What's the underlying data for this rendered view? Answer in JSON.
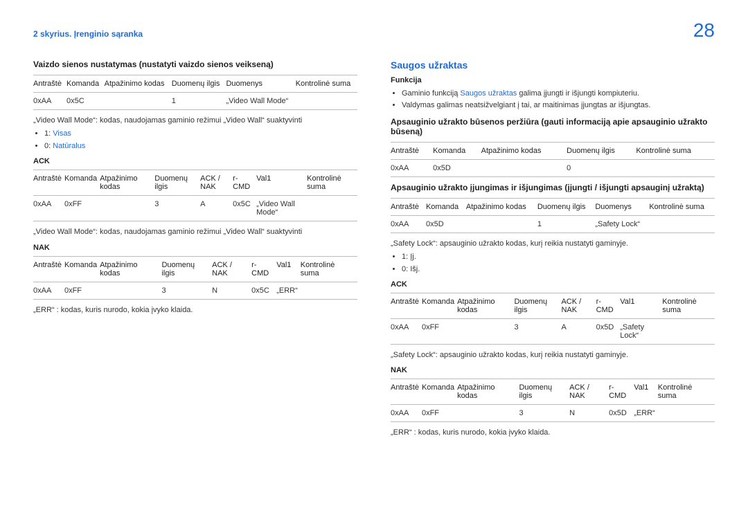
{
  "header": {
    "chapter": "2 skyrius. Įrenginio sąranka",
    "page_number": "28"
  },
  "left": {
    "h1": "Vaizdo sienos nustatymas (nustatyti vaizdo sienos veikseną)",
    "t1": {
      "head": [
        "Antraštė",
        "Komanda",
        "Atpažinimo kodas",
        "Duomenų ilgis",
        "Duomenys",
        "Kontrolinė suma"
      ],
      "row": [
        "0xAA",
        "0x5C",
        "",
        "1",
        "„Video Wall Mode“",
        ""
      ]
    },
    "t1_note": "„Video Wall Mode“: kodas, naudojamas gaminio režimui „Video Wall“ suaktyvinti",
    "t1_bullets": [
      {
        "prefix": "1: ",
        "value": "Visas"
      },
      {
        "prefix": "0: ",
        "value": "Natūralus"
      }
    ],
    "ack_label": "ACK",
    "t2": {
      "head": [
        "Antraštė",
        "Komanda",
        "Atpažinimo kodas",
        "Duomenų ilgis",
        "ACK / NAK",
        "r-CMD",
        "Val1",
        "Kontrolinė suma"
      ],
      "row": [
        "0xAA",
        "0xFF",
        "",
        "3",
        "A",
        "0x5C",
        "„Video Wall Mode“",
        ""
      ]
    },
    "t2_note": "„Video Wall Mode“: kodas, naudojamas gaminio režimui „Video Wall“ suaktyvinti",
    "nak_label": "NAK",
    "t3": {
      "head": [
        "Antraštė",
        "Komanda",
        "Atpažinimo kodas",
        "Duomenų ilgis",
        "ACK / NAK",
        "r-CMD",
        "Val1",
        "Kontrolinė suma"
      ],
      "row": [
        "0xAA",
        "0xFF",
        "",
        "3",
        "N",
        "0x5C",
        "„ERR“",
        ""
      ]
    },
    "t3_note": "„ERR“ : kodas, kuris nurodo, kokia įvyko klaida."
  },
  "right": {
    "section_title": "Saugos užraktas",
    "func_label": "Funkcija",
    "func_b1_a": "Gaminio funkciją ",
    "func_b1_b": "Saugos užraktas",
    "func_b1_c": " galima įjungti ir išjungti kompiuteriu.",
    "func_b2": "Valdymas galimas neatsižvelgiant į tai, ar maitinimas įjungtas ar išjungtas.",
    "h2": "Apsauginio užrakto būsenos peržiūra (gauti informaciją apie apsauginio užrakto būseną)",
    "t4": {
      "head": [
        "Antraštė",
        "Komanda",
        "Atpažinimo kodas",
        "Duomenų ilgis",
        "Kontrolinė suma"
      ],
      "row": [
        "0xAA",
        "0x5D",
        "",
        "0",
        ""
      ]
    },
    "h3": "Apsauginio užrakto įjungimas ir išjungimas (įjungti / išjungti apsauginį užraktą)",
    "t5": {
      "head": [
        "Antraštė",
        "Komanda",
        "Atpažinimo kodas",
        "Duomenų ilgis",
        "Duomenys",
        "Kontrolinė suma"
      ],
      "row": [
        "0xAA",
        "0x5D",
        "",
        "1",
        "„Safety Lock“",
        ""
      ]
    },
    "t5_note": "„Safety Lock“: apsauginio užrakto kodas, kurį reikia nustatyti gaminyje.",
    "t5_bullets": [
      "1: Įj.",
      "0: Išj."
    ],
    "ack_label": "ACK",
    "t6": {
      "head": [
        "Antraštė",
        "Komanda",
        "Atpažinimo kodas",
        "Duomenų ilgis",
        "ACK / NAK",
        "r-CMD",
        "Val1",
        "Kontrolinė suma"
      ],
      "row": [
        "0xAA",
        "0xFF",
        "",
        "3",
        "A",
        "0x5D",
        "„Safety Lock“",
        ""
      ]
    },
    "t6_note": "„Safety Lock“: apsauginio užrakto kodas, kurį reikia nustatyti gaminyje.",
    "nak_label": "NAK",
    "t7": {
      "head": [
        "Antraštė",
        "Komanda",
        "Atpažinimo kodas",
        "Duomenų ilgis",
        "ACK / NAK",
        "r-CMD",
        "Val1",
        "Kontrolinė suma"
      ],
      "row": [
        "0xAA",
        "0xFF",
        "",
        "3",
        "N",
        "0x5D",
        "„ERR“",
        ""
      ]
    },
    "t7_note": "„ERR“ : kodas, kuris nurodo, kokia įvyko klaida."
  }
}
